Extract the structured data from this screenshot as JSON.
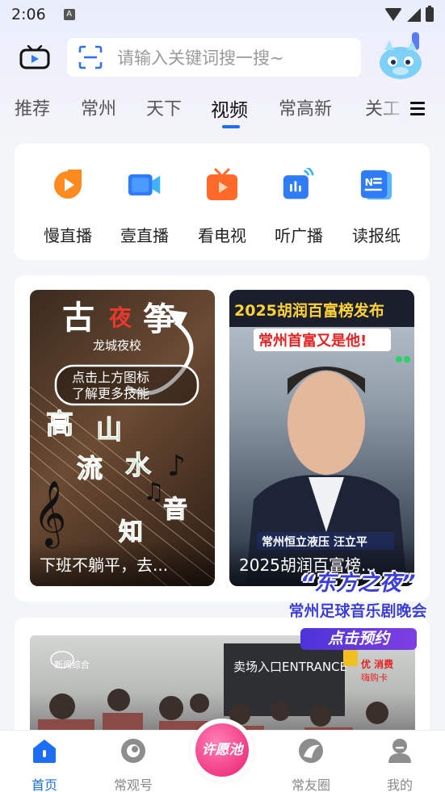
{
  "status_bar": {
    "time": "2:06",
    "notification_icon": "A"
  },
  "header": {
    "search_placeholder": "请输入关键词搜一搜~",
    "tv_icon": "tv-icon",
    "scan_icon": "scan-icon",
    "mascot_icon": "dragon-mascot-icon"
  },
  "tabs": [
    {
      "label": "推荐"
    },
    {
      "label": "常州"
    },
    {
      "label": "天下"
    },
    {
      "label": "视频"
    },
    {
      "label": "常高新"
    },
    {
      "label": "关工"
    }
  ],
  "active_tab": "视频",
  "services": [
    {
      "label": "慢直播",
      "icon": "slow-live-icon",
      "color": "#ff8a1e"
    },
    {
      "label": "壹直播",
      "icon": "camera-icon",
      "color": "#2f7cf6"
    },
    {
      "label": "看电视",
      "icon": "tv-play-icon",
      "color": "#ff6a2b"
    },
    {
      "label": "听广播",
      "icon": "radio-icon",
      "color": "#2f7cf6"
    },
    {
      "label": "读报纸",
      "icon": "newspaper-icon",
      "color": "#2f7cf6"
    }
  ],
  "videos": [
    {
      "caption": "下班不躺平，去...",
      "overlay_title": "古夜筝",
      "overlay_sub": "龙城夜校",
      "overlay_bubble": "点击上方图标 了解更多技能",
      "overlay_verse": "高山 流水 音 知"
    },
    {
      "caption": "2025胡润百富榜...",
      "overlay_title": "2025胡润百富榜发布",
      "overlay_sub": "常州首富又是他!",
      "overlay_lower": "常州恒立液压 汪立平"
    }
  ],
  "news": {
    "logo_text": "新闻综合",
    "sign_text": "卖场入口ENTRANCE",
    "promo_sticker": "优 消费 嗨购卡"
  },
  "promo": {
    "title": "“东方之夜”",
    "subtitle": "常州足球音乐剧晚会",
    "button": "点击预约"
  },
  "bottom_nav": [
    {
      "label": "首页",
      "icon": "home-icon",
      "active": true
    },
    {
      "label": "常观号",
      "icon": "changguan-icon",
      "active": false
    },
    {
      "label": "许愿池",
      "icon": "wish-pool-icon",
      "active": false
    },
    {
      "label": "常友圈",
      "icon": "circle-icon",
      "active": false
    },
    {
      "label": "我的",
      "icon": "user-icon",
      "active": false
    }
  ],
  "colors": {
    "accent": "#1e6ef5",
    "promo": "#3b3fd8",
    "wish": "#f13a85"
  }
}
